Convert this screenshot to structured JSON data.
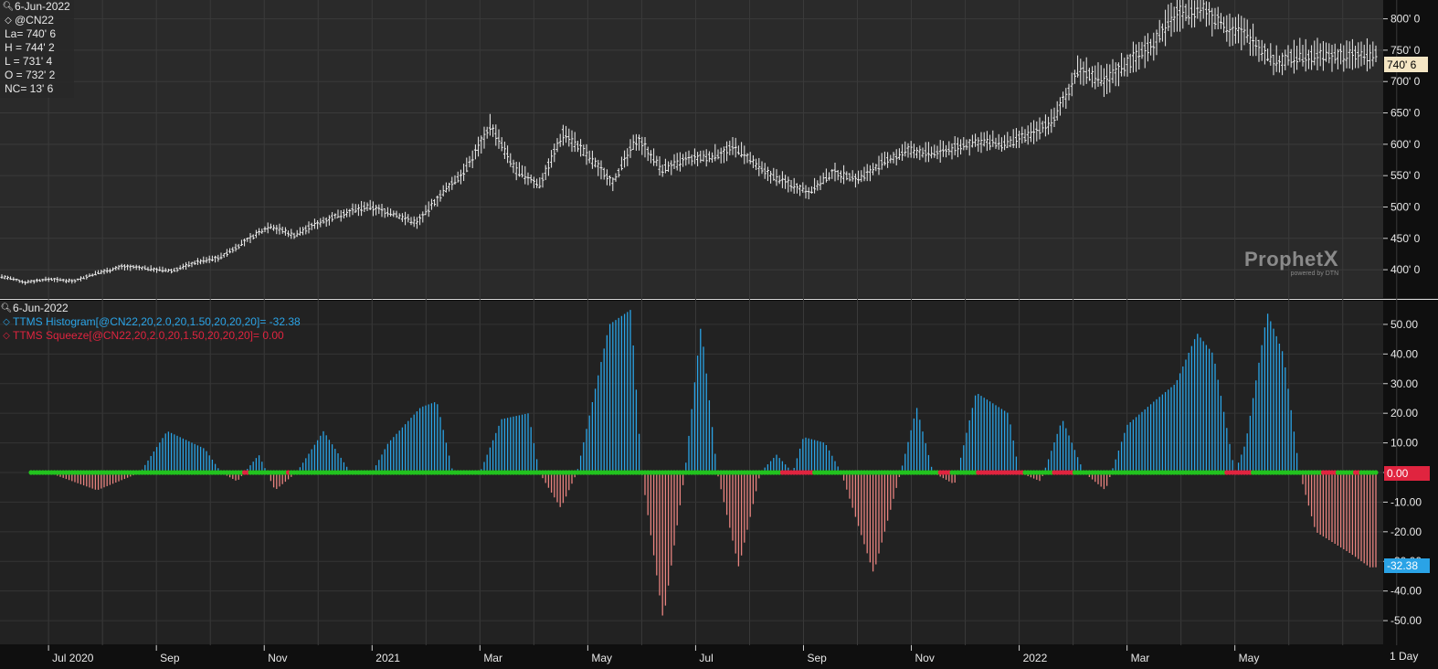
{
  "price_legend": {
    "date": "6-Jun-2022",
    "symbol": "@CN22",
    "stats": [
      "La= 740' 6",
      "H = 744' 2",
      "L = 731' 4",
      "O = 732' 2",
      "NC= 13' 6"
    ]
  },
  "indicator_legend": {
    "date": "6-Jun-2022",
    "histogram_label": "TTMS Histogram[@CN22,20,2.0,20,1.50,20,20,20]= -32.38",
    "squeeze_label": "TTMS Squeeze[@CN22,20,2.0,20,1.50,20,20,20]= 0.00"
  },
  "logo": {
    "text": "Prophet",
    "suffix": "X",
    "sub": "powered by DTN"
  },
  "time_axis": {
    "labels": [
      "Jul 2020",
      "Sep",
      "Nov",
      "2021",
      "Mar",
      "May",
      "Jul",
      "Sep",
      "Nov",
      "2022",
      "Mar",
      "May"
    ],
    "interval_label": "1 Day"
  },
  "colors": {
    "background": "#0f0f0f",
    "price_bars": "#f0f0f0",
    "histogram_positive": "#2aa3e6",
    "histogram_negative": "#e8837f",
    "squeeze_on": "#e0243f",
    "squeeze_off": "#22c21e",
    "last_price_tag": "#f5e6c4",
    "histogram_tag": "#2aa3e6",
    "squeeze_tag": "#e0243f"
  },
  "chart_data": [
    {
      "type": "line",
      "series_type": "ohlc-bars",
      "y_tick_labels": [
        "800' 0",
        "750' 0",
        "700' 0",
        "650' 0",
        "600' 0",
        "550' 0",
        "500' 0",
        "450' 0",
        "400' 0"
      ],
      "y_ticks": [
        800,
        750,
        700,
        650,
        600,
        550,
        500,
        450,
        400
      ],
      "ylim": [
        355,
        830
      ],
      "last_value": 740.75,
      "last_value_label": "740' 6",
      "x_months": [
        0,
        2,
        4,
        6,
        8,
        10,
        12,
        14,
        16,
        18,
        20,
        22,
        23.2
      ],
      "values": [
        390,
        380,
        385,
        382,
        395,
        405,
        402,
        398,
        412,
        420,
        445,
        470,
        455,
        475,
        490,
        500,
        490,
        475,
        520,
        560,
        630,
        560,
        535,
        620,
        580,
        540,
        610,
        560,
        575,
        580,
        595,
        560,
        540,
        525,
        555,
        545,
        570,
        590,
        585,
        595,
        605,
        600,
        615,
        640,
        720,
        700,
        730,
        760,
        810,
        815,
        790,
        770,
        730,
        741
      ]
    },
    {
      "type": "bar",
      "series": [
        {
          "name": "TTMS Histogram",
          "values": [
            0,
            -6,
            0,
            14,
            8,
            0,
            -3,
            6,
            -6,
            0,
            14,
            0,
            0,
            10,
            22,
            24,
            0,
            0,
            18,
            20,
            0,
            -12,
            0,
            50,
            55,
            0,
            -50,
            0,
            50,
            0,
            -32,
            0,
            6,
            0,
            12,
            10,
            0,
            -34,
            0,
            22,
            0,
            -4,
            27,
            20,
            0,
            -3,
            18,
            0,
            -6,
            16,
            24,
            30,
            47,
            40,
            0,
            10,
            54,
            40,
            0,
            -20,
            -28,
            -32
          ]
        }
      ],
      "x_months": [
        0,
        0.9,
        1.7,
        2.2,
        2.9,
        3.2,
        3.5,
        3.9,
        4.2,
        4.6,
        5.1,
        5.6,
        6.0,
        6.3,
        6.9,
        7.2,
        7.5,
        8.0,
        8.4,
        8.9,
        9.1,
        9.5,
        9.8,
        10.4,
        10.8,
        11.0,
        11.4,
        11.8,
        12.1,
        12.4,
        12.8,
        13.2,
        13.5,
        13.8,
        14.0,
        14.4,
        14.7,
        15.3,
        15.8,
        16.1,
        16.4,
        16.8,
        17.2,
        17.8,
        18.0,
        18.4,
        18.8,
        19.2,
        19.6,
        20.0,
        20.5,
        20.9,
        21.3,
        21.6,
        22.0,
        22.2,
        22.6,
        22.9,
        23.2,
        23.5,
        24.2,
        24.5
      ],
      "squeeze_on_intervals_months": [
        [
          3.6,
          3.7
        ],
        [
          4.4,
          4.5
        ],
        [
          13.6,
          14.2
        ],
        [
          16.5,
          16.7
        ],
        [
          17.2,
          18.1
        ],
        [
          18.6,
          19.0
        ],
        [
          21.8,
          22.3
        ],
        [
          23.6,
          23.9
        ],
        [
          24.2,
          24.3
        ]
      ],
      "y_tick_labels": [
        "50.00",
        "40.00",
        "30.00",
        "20.00",
        "10.00",
        "0.00",
        "-10.00",
        "-20.00",
        "-30.00",
        "-40.00",
        "-50.00"
      ],
      "y_ticks": [
        50,
        40,
        30,
        20,
        10,
        0,
        -10,
        -20,
        -30,
        -40,
        -50
      ],
      "ylim": [
        -58,
        58
      ],
      "last_histogram": -32.38,
      "last_histogram_label": "-32.38",
      "last_squeeze_label": "0.00"
    }
  ]
}
